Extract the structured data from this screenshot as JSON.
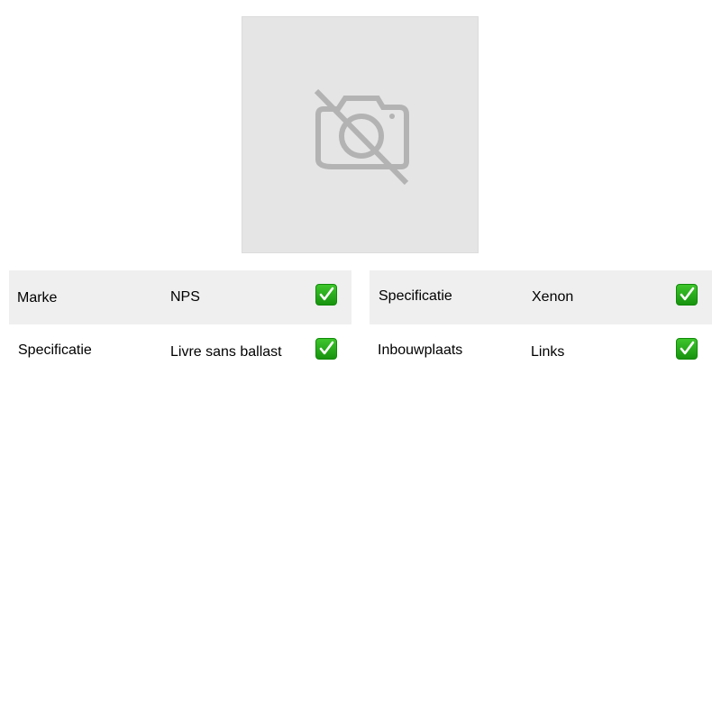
{
  "image": {
    "icon": "camera-off-icon",
    "colors": {
      "background": "#e5e5e5",
      "icon": "#b3b3b3"
    }
  },
  "specs_left": [
    {
      "label": "Marke",
      "value": "NPS",
      "checked": true
    },
    {
      "label": "Specificatie",
      "value": "Livre sans ballast",
      "checked": true
    }
  ],
  "specs_right": [
    {
      "label": "Specificatie",
      "value": "Xenon",
      "checked": true
    },
    {
      "label": "Inbouwplaats",
      "value": "Links",
      "checked": true
    }
  ],
  "colors": {
    "row_shade": "#efefef",
    "check_green": "#22a816"
  }
}
